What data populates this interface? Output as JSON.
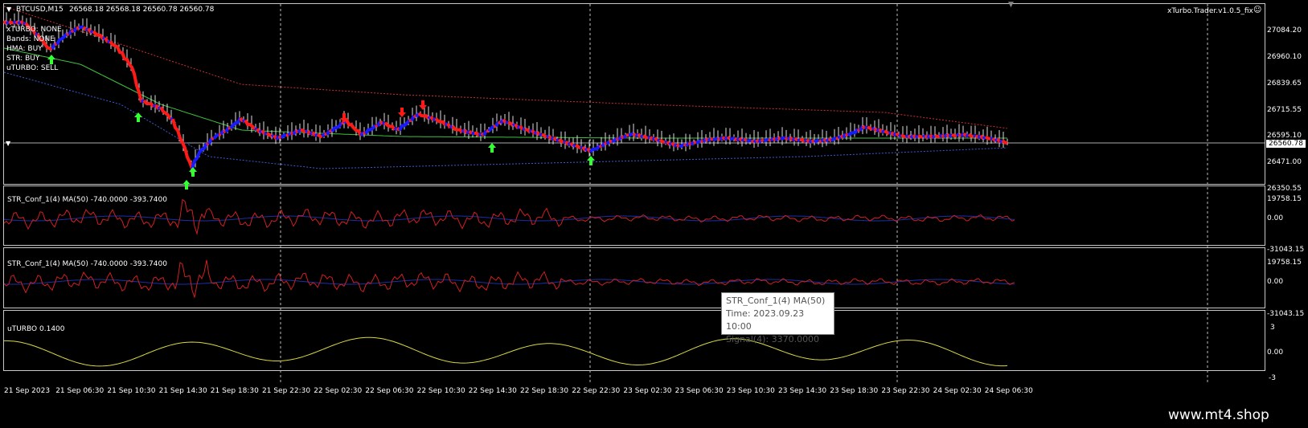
{
  "main": {
    "symbol": "BTCUSD,M15",
    "ohlc": "26568.18 26568.18 26560.78 26560.78",
    "indicator_title": "xTurbo.Trader.v1.0.5_fix",
    "status": [
      "xTURBO: NONE",
      "Bands: NONE",
      "HMA: BUY",
      "STR: BUY",
      "uTURBO: SELL"
    ],
    "price_labels": [
      "27084.20",
      "26960.10",
      "26839.65",
      "26715.55",
      "26595.10",
      "26471.00",
      "26350.55"
    ],
    "current_price": "26560.78"
  },
  "sub1": {
    "title": "STR_Conf_1(4) MA(50) -740.0000 -393.7400",
    "scale": [
      "19758.15",
      "0.00",
      "-31043.15"
    ]
  },
  "sub2": {
    "title": "STR_Conf_1(4) MA(50) -740.0000 -393.7400",
    "scale": [
      "19758.15",
      "0.00",
      "-31043.15"
    ]
  },
  "sub3": {
    "title": "uTURBO 0.1400",
    "scale": [
      "3",
      "0.00",
      "-3"
    ]
  },
  "tooltip": {
    "line1": "STR_Conf_1(4) MA(50)",
    "line2": "Time: 2023.09.23 10:00",
    "line3": "Signal(4): 3370.0000"
  },
  "time_axis": [
    "21 Sep 2023",
    "21 Sep 06:30",
    "21 Sep 10:30",
    "21 Sep 14:30",
    "21 Sep 18:30",
    "21 Sep 22:30",
    "22 Sep 02:30",
    "22 Sep 06:30",
    "22 Sep 10:30",
    "22 Sep 14:30",
    "22 Sep 18:30",
    "22 Sep 22:30",
    "23 Sep 02:30",
    "23 Sep 06:30",
    "23 Sep 10:30",
    "23 Sep 14:30",
    "23 Sep 18:30",
    "23 Sep 22:30",
    "24 Sep 02:30",
    "24 Sep 06:30"
  ],
  "watermark": "www.mt4.shop",
  "colors": {
    "uptrend": "#1a1aff",
    "downtrend": "#ff1a1a",
    "buy_arrow": "#33ff33",
    "sell_arrow": "#ff1a1a",
    "ma_green": "#3fbf3f",
    "band_red": "#c83232",
    "band_blue": "#3c5ad2",
    "osc_red": "#d02020",
    "osc_blue": "#1b2fa8",
    "uturbo": "#d8d840"
  }
}
